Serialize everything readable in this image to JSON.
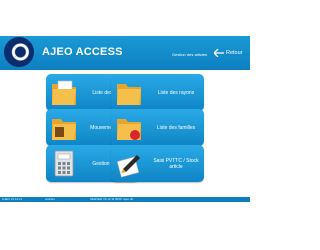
{
  "app": {
    "title": "AJEO ACCESS",
    "section": "Gestion des articles",
    "back_label": "Retour"
  },
  "tiles": [
    {
      "label": "Liste des articles",
      "icon": "folder-articles-icon"
    },
    {
      "label": "Liste des rayons",
      "icon": "folder-rayons-icon"
    },
    {
      "label": "Mouvements stock",
      "icon": "folder-stock-icon"
    },
    {
      "label": "Liste des familles",
      "icon": "folder-familles-icon"
    },
    {
      "label": "Gestion des TVA",
      "icon": "calculator-icon"
    },
    {
      "label": "Saisi PVTTC / Stock article",
      "icon": "folder-edit-icon"
    }
  ],
  "status": {
    "left": "AJEO  15:12:11",
    "middle": "Articles",
    "right": "SERVER  15:12:11    BDD: ajeo.db"
  },
  "colors": {
    "primary": "#1a9ad6",
    "tile": "#1d96d8",
    "folder": "#f2b23b"
  }
}
